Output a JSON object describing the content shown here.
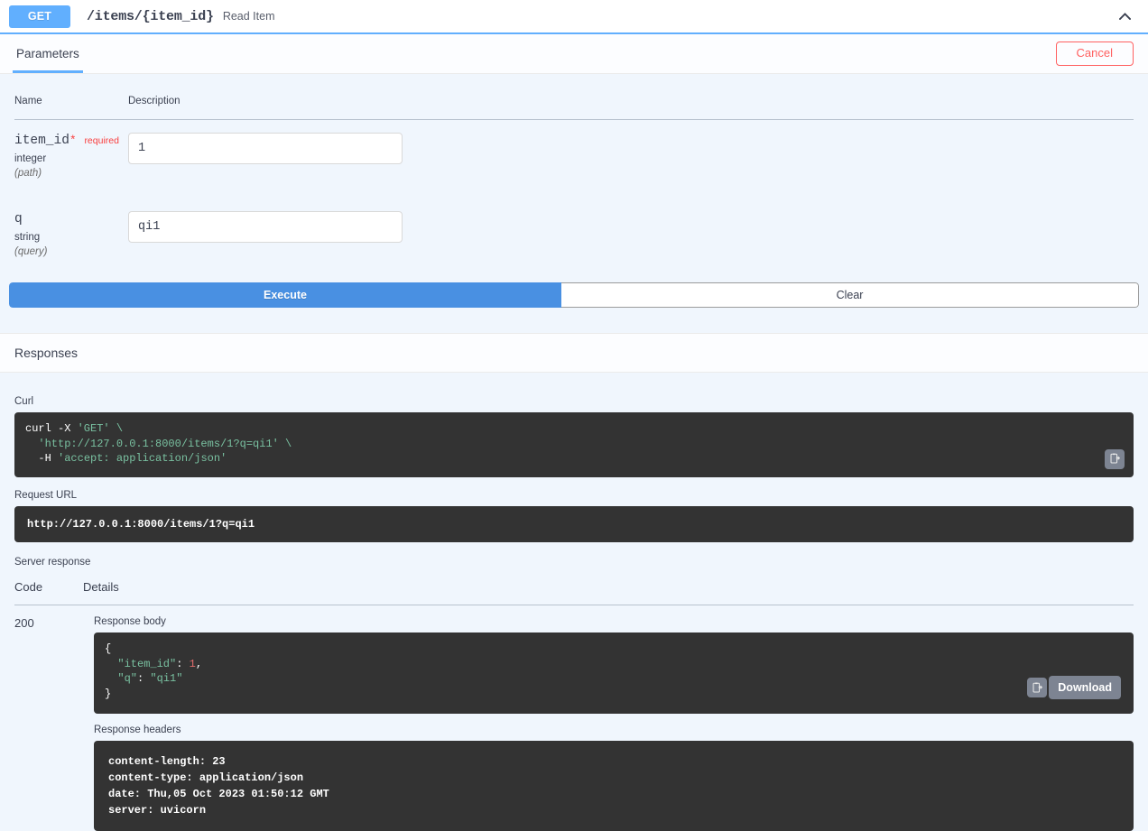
{
  "operation": {
    "method": "GET",
    "path": "/items/{item_id}",
    "summary": "Read Item",
    "collapse_icon": "chevron-up-icon"
  },
  "tabs": {
    "parameters_label": "Parameters",
    "cancel_label": "Cancel"
  },
  "parameters": {
    "header_name": "Name",
    "header_description": "Description",
    "rows": [
      {
        "name": "item_id",
        "required_star": "*",
        "required_label": "required",
        "type": "integer",
        "location": "(path)",
        "value": "1",
        "placeholder": "item_id"
      },
      {
        "name": "q",
        "required_star": "",
        "required_label": "",
        "type": "string",
        "location": "(query)",
        "value": "qi1",
        "placeholder": "q"
      }
    ]
  },
  "actions": {
    "execute_label": "Execute",
    "clear_label": "Clear"
  },
  "responses": {
    "section_title": "Responses",
    "curl_label": "Curl",
    "curl_line1_cmd": "curl -X ",
    "curl_line1_arg": "'GET'",
    "curl_line1_cont": " \\",
    "curl_line2_url": "  'http://127.0.0.1:8000/items/1?q=qi1'",
    "curl_line2_cont": " \\",
    "curl_line3_flag": "  -H ",
    "curl_line3_arg": "'accept: application/json'",
    "copy_curl_icon": "copy-icon",
    "request_url_label": "Request URL",
    "request_url_value": "http://127.0.0.1:8000/items/1?q=qi1",
    "server_response_label": "Server response",
    "table_header_code": "Code",
    "table_header_details": "Details",
    "status_code": "200",
    "response_body_label": "Response body",
    "body_line1": "{",
    "body_line2_key": "  \"item_id\"",
    "body_line2_sep": ": ",
    "body_line2_val": "1",
    "body_line2_comma": ",",
    "body_line3_key": "  \"q\"",
    "body_line3_sep": ": ",
    "body_line3_val": "\"qi1\"",
    "body_line4": "}",
    "copy_body_icon": "copy-icon",
    "download_label": "Download",
    "response_headers_label": "Response headers",
    "headers_text": "content-length: 23\ncontent-type: application/json\ndate: Thu,05 Oct 2023 01:50:12 GMT\nserver: uvicorn"
  },
  "colors": {
    "method_get": "#61affe",
    "accent_blue": "#4990e2",
    "cancel_red": "#ff6060",
    "required_red": "#f93e3e",
    "content_bg": "#f0f6fd",
    "code_bg": "#333333",
    "string_green": "#79c0a0",
    "number_red": "#e06c6c"
  }
}
